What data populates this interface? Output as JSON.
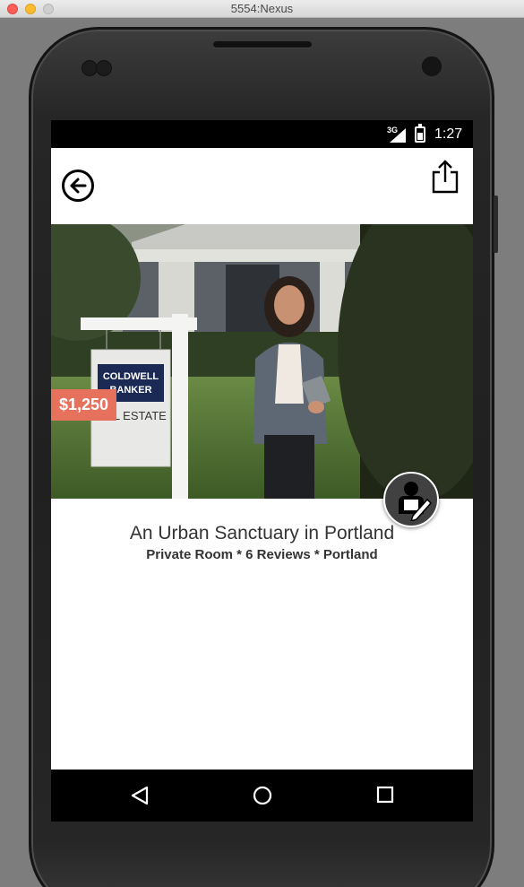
{
  "window": {
    "title": "5554:Nexus"
  },
  "status_bar": {
    "network": "3G",
    "time": "1:27"
  },
  "app_bar": {
    "back_icon": "back-arrow-circle-icon",
    "share_icon": "share-upload-icon"
  },
  "listing": {
    "price": "$1,250",
    "title": "An Urban Sanctuary in Portland",
    "subtitle": "Private Room * 6 Reviews * Portland",
    "sign_text_1": "COLDWELL",
    "sign_text_2": "BANKER",
    "sign_text_3": "AL ESTATE",
    "fab_icon": "agent-edit-icon"
  },
  "nav_bar": {
    "back_icon": "nav-back-triangle-icon",
    "home_icon": "nav-home-circle-icon",
    "recent_icon": "nav-recents-square-icon"
  },
  "colors": {
    "price_tag": "#e6725e",
    "fab": "#414141"
  }
}
